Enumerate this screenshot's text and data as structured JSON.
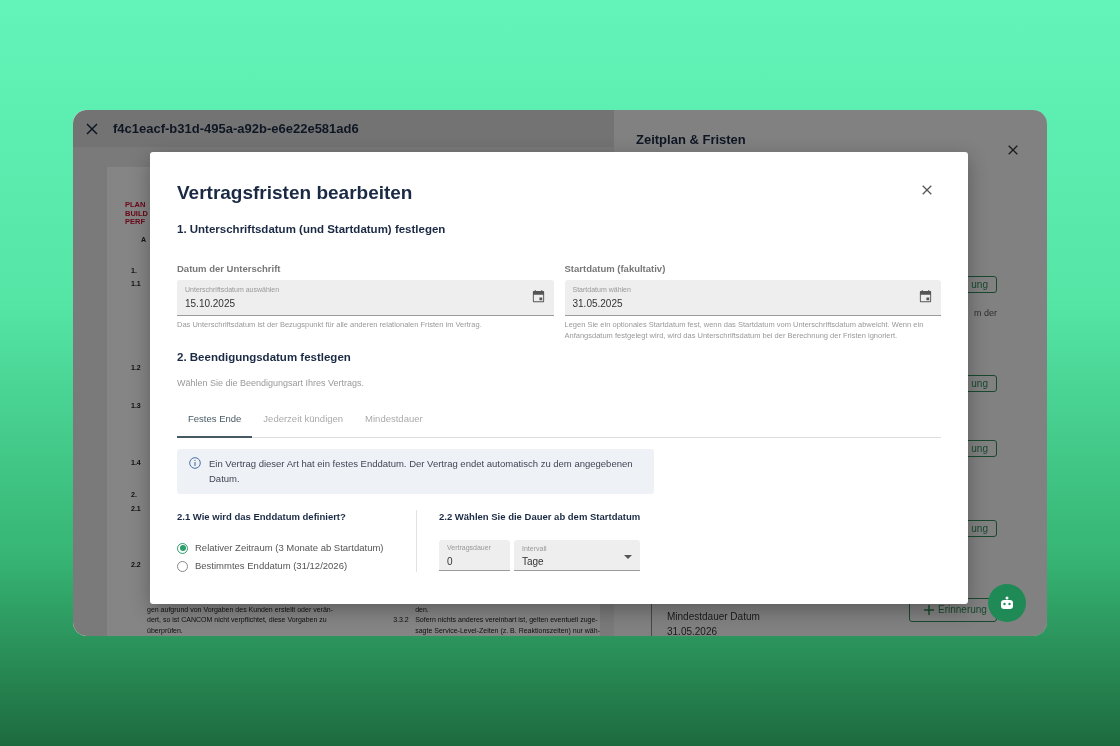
{
  "app": {
    "document_id": "f4c1eacf-b31d-495a-a92b-e6e22e581ad6"
  },
  "document": {
    "logo_lines": [
      "PLAN",
      "BUILD",
      "PERF"
    ],
    "heading": "A",
    "section_numbers": [
      "1.",
      "1.1",
      "1.2",
      "1.3",
      "1.4",
      "2.",
      "2.1",
      "2.2"
    ],
    "bottom_left_lines": [
      "gen aufgrund von Vorgaben des Kunden erstellt oder verän-",
      "dert, so ist CANCOM nicht verpflichtet, diese Vorgaben zu",
      "überprüfen."
    ],
    "bottom_right_lines": [
      {
        "text": "den."
      },
      {
        "number": "3.3.2",
        "text": "Sofern nichts anderes vereinbart ist, gelten eventuell zuge-"
      },
      {
        "text": "sagte Service-Level-Zeiten (z. B. Reaktionszeiten) nur wäh-"
      }
    ]
  },
  "side_panel": {
    "title": "Zeitplan & Fristen",
    "reminder_buttons": [
      "ung",
      "ung",
      "ung",
      "ung"
    ],
    "partial_text": "m der",
    "entry_title": "Mindestdauer Datum",
    "entry_date": "31.05.2026",
    "add_button": "Erinnerung"
  },
  "modal": {
    "title": "Vertragsfristen bearbeiten",
    "section1": {
      "heading": "1. Unterschriftsdatum (und Startdatum) festlegen",
      "fields": [
        {
          "heading": "Datum der Unterschrift",
          "label": "Unterschriftsdatum auswählen",
          "value": "15.10.2025",
          "hint": "Das Unterschriftsdatum ist der Bezugspunkt für alle anderen relationalen Fristen im Vertrag."
        },
        {
          "heading": "Startdatum (fakultativ)",
          "label": "Startdatum wählen",
          "value": "31.05.2025",
          "hint": "Legen Sie ein optionales Startdatum fest, wenn das Startdatum vom Unterschriftsdatum abweicht. Wenn ein Anfangsdatum festgelegt wird, wird das Unterschriftsdatum bei der Berechnung der Fristen ignoriert."
        }
      ]
    },
    "section2": {
      "heading": "2. Beendigungsdatum festlegen",
      "subtitle": "Wählen Sie die Beendigungsart Ihres Vertrags.",
      "tabs": [
        {
          "label": "Festes Ende",
          "selected": true
        },
        {
          "label": "Jederzeit kündigen",
          "selected": false
        },
        {
          "label": "Mindestdauer",
          "selected": false
        }
      ],
      "info": "Ein Vertrag dieser Art hat ein festes Enddatum. Der Vertrag endet automatisch zu dem angegebenen Datum.",
      "end_definition": {
        "heading": "2.1 Wie wird das Enddatum definiert?",
        "options": [
          {
            "label": "Relativer Zeitraum (3 Monate ab Startdatum)",
            "selected": true
          },
          {
            "label": "Bestimmtes Enddatum (31/12/2026)",
            "selected": false
          }
        ]
      },
      "duration": {
        "heading": "2.2 Wählen Sie die Dauer ab dem Startdatum",
        "fields": [
          {
            "kind": "input",
            "label": "Vertragsdauer",
            "value": "0"
          },
          {
            "kind": "select",
            "label": "Intervall",
            "value": "Tage"
          }
        ]
      }
    }
  }
}
